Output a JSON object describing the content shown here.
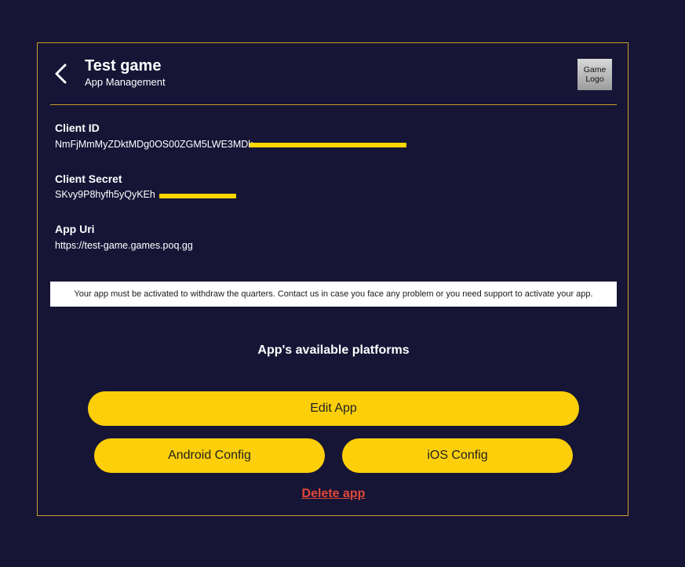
{
  "header": {
    "title": "Test game",
    "subtitle": "App Management",
    "logo_text": "Game Logo",
    "back_icon": "chevron-left-icon"
  },
  "fields": [
    {
      "label": "Client ID",
      "value": "NmFjMmMyZDktMDg0OS00ZGM5LWE3MDk"
    },
    {
      "label": "Client Secret",
      "value": "SKvy9P8hyfh5yQyKEh"
    },
    {
      "label": "App Uri",
      "value": "https://test-game.games.poq.gg"
    }
  ],
  "notice": "Your app must be activated to withdraw the quarters. Contact us in case you face any problem or you need support to activate your app.",
  "platforms_title": "App's available platforms",
  "buttons": {
    "edit": "Edit App",
    "android": "Android Config",
    "ios": "iOS Config",
    "delete": "Delete app"
  },
  "colors": {
    "background": "#161536",
    "accent": "#fccf0a",
    "border": "#c9a227",
    "danger": "#e0483a",
    "redaction": "#ffd500"
  }
}
